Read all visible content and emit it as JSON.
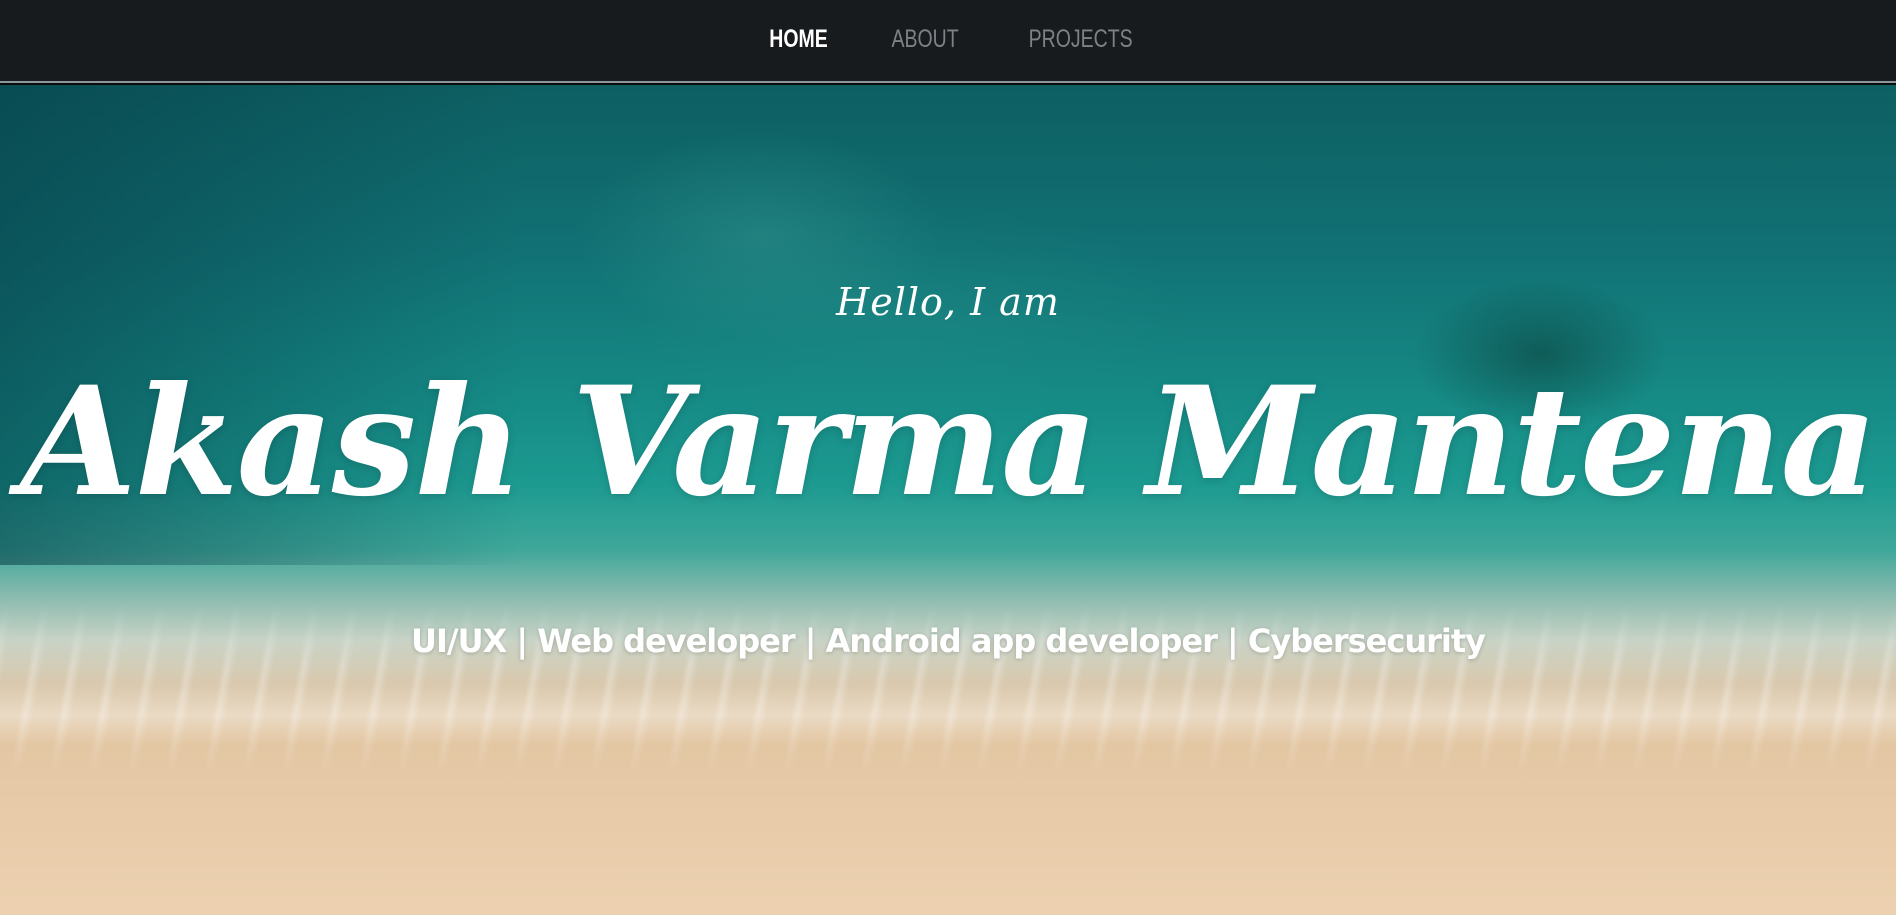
{
  "nav": {
    "items": [
      {
        "label": "HOME",
        "active": true
      },
      {
        "label": "ABOUT",
        "active": false
      },
      {
        "label": "PROJECTS",
        "active": false
      }
    ]
  },
  "hero": {
    "greeting": "Hello, I am",
    "name": "Akash Varma Mantena",
    "roles": "UI/UX | Web developer | Android app developer | Cybersecurity",
    "background_image": "aerial-beach-ocean-waves"
  },
  "colors": {
    "navbar_bg": "#181b1e",
    "nav_active": "#ffffff",
    "nav_inactive": "#7d8287",
    "hero_text": "#ffffff",
    "water": "#117174",
    "sand": "#e8cba9"
  }
}
